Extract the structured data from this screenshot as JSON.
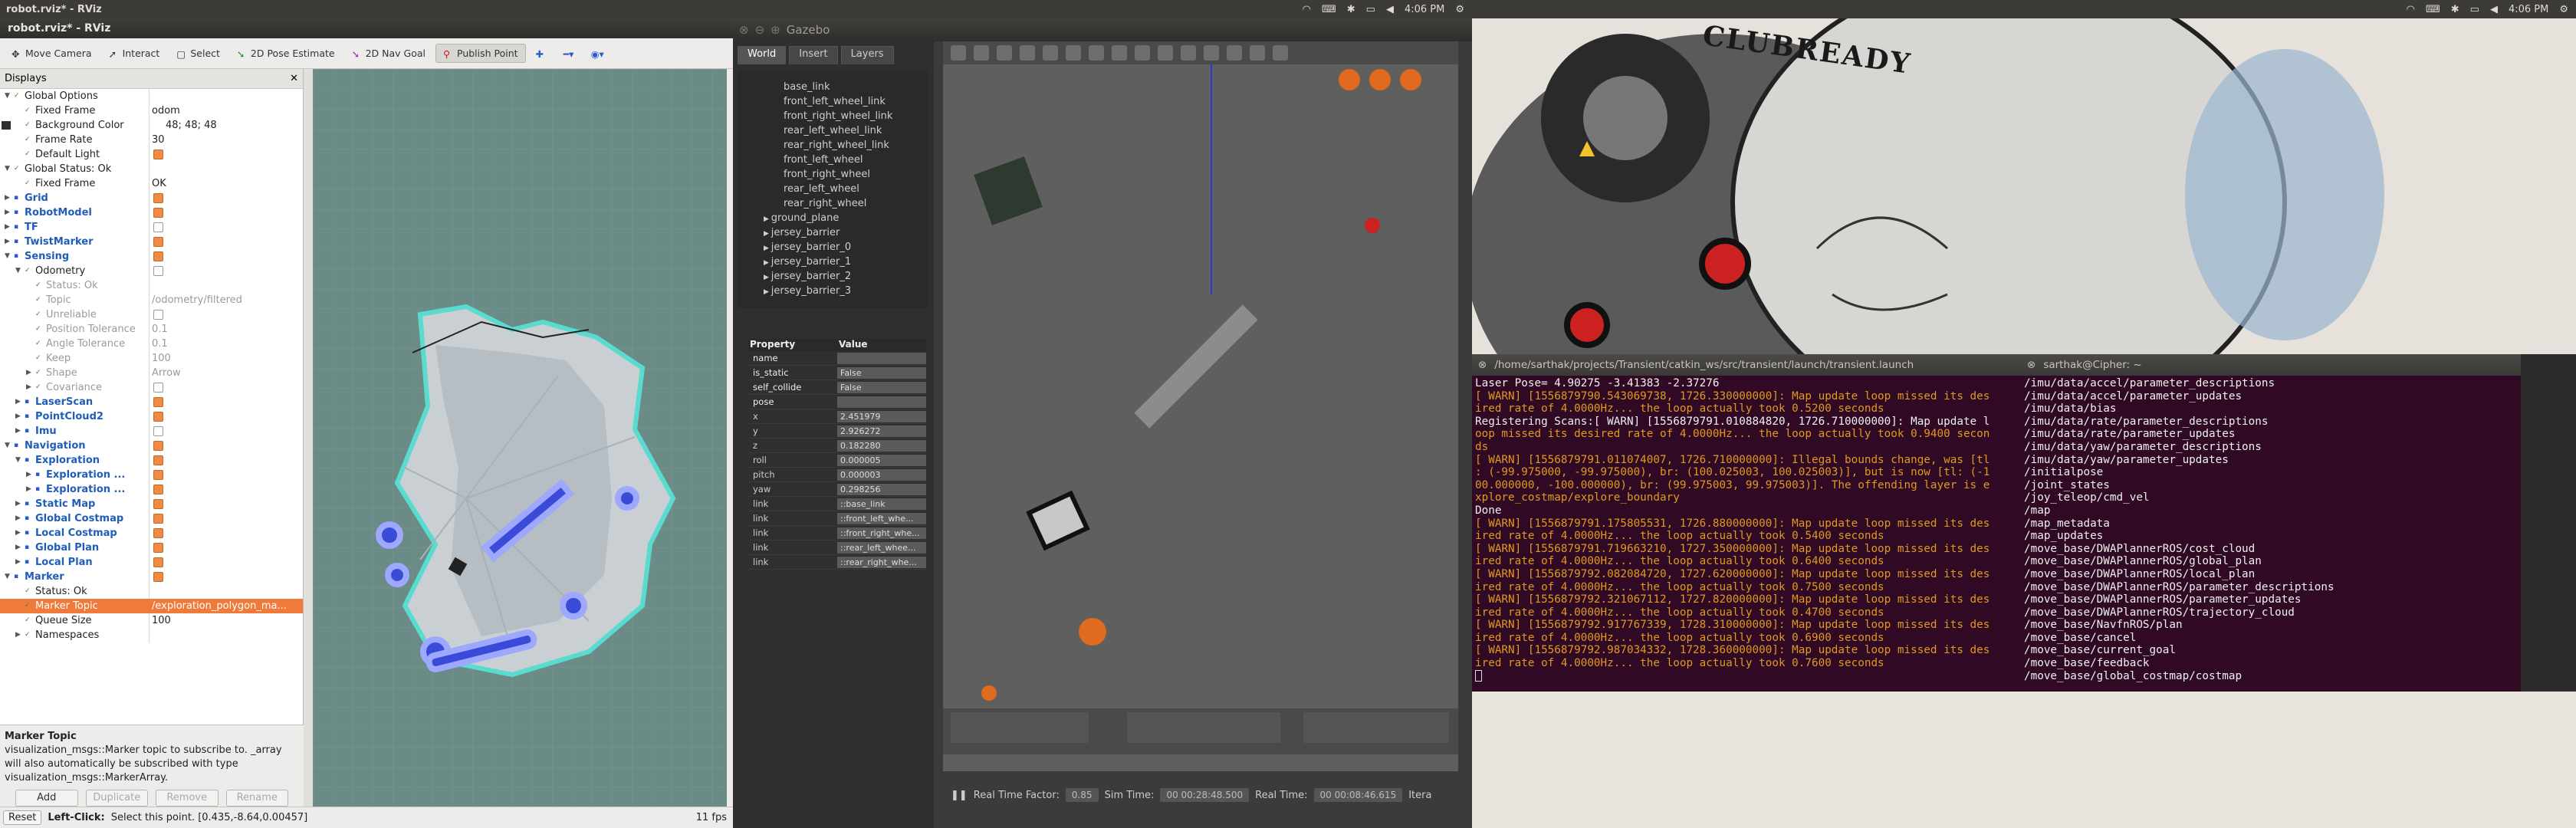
{
  "top_left_bar": {
    "title": "robot.rviz* - RViz"
  },
  "top_mid_bar": {
    "time": "4:06 PM"
  },
  "top_right_bar": {
    "time": "4:06 PM"
  },
  "rviz": {
    "window_title": "robot.rviz* - RViz",
    "toolbar": [
      "Move Camera",
      "Interact",
      "Select",
      "2D Pose Estimate",
      "2D Nav Goal",
      "Publish Point"
    ],
    "panel_title": "Displays",
    "rows": [
      {
        "name": "Global Options",
        "val": "",
        "ind": 0,
        "exp": "v",
        "blue": false
      },
      {
        "name": "Fixed Frame",
        "val": "odom",
        "ind": 1
      },
      {
        "name": "Background Color",
        "val": "48; 48; 48",
        "ind": 1,
        "swatch": true
      },
      {
        "name": "Frame Rate",
        "val": "30",
        "ind": 1
      },
      {
        "name": "Default Light",
        "val": "",
        "ind": 1,
        "chk": "on"
      },
      {
        "name": "Global Status: Ok",
        "val": "",
        "ind": 0,
        "exp": "v"
      },
      {
        "name": "Fixed Frame",
        "val": "OK",
        "ind": 1
      },
      {
        "name": "Grid",
        "val": "",
        "ind": 0,
        "exp": ">",
        "blue": true,
        "chk": "on"
      },
      {
        "name": "RobotModel",
        "val": "",
        "ind": 0,
        "exp": ">",
        "blue": true,
        "chk": "on"
      },
      {
        "name": "TF",
        "val": "",
        "ind": 0,
        "exp": ">",
        "blue": true,
        "chk": "off"
      },
      {
        "name": "TwistMarker",
        "val": "",
        "ind": 0,
        "exp": ">",
        "blue": true,
        "chk": "on"
      },
      {
        "name": "Sensing",
        "val": "",
        "ind": 0,
        "exp": "v",
        "blue": true,
        "chk": "on"
      },
      {
        "name": "Odometry",
        "val": "",
        "ind": 1,
        "exp": "v",
        "chk": "off"
      },
      {
        "name": "Status: Ok",
        "val": "",
        "ind": 2,
        "dim": true
      },
      {
        "name": "Topic",
        "val": "/odometry/filtered",
        "ind": 2,
        "dim": true
      },
      {
        "name": "Unreliable",
        "val": "",
        "ind": 2,
        "dim": true,
        "chk": "off"
      },
      {
        "name": "Position Tolerance",
        "val": "0.1",
        "ind": 2,
        "dim": true
      },
      {
        "name": "Angle Tolerance",
        "val": "0.1",
        "ind": 2,
        "dim": true
      },
      {
        "name": "Keep",
        "val": "100",
        "ind": 2,
        "dim": true
      },
      {
        "name": "Shape",
        "val": "Arrow",
        "ind": 2,
        "dim": true,
        "exp": ">"
      },
      {
        "name": "Covariance",
        "val": "",
        "ind": 2,
        "dim": true,
        "exp": ">",
        "chk": "off"
      },
      {
        "name": "LaserScan",
        "val": "",
        "ind": 1,
        "exp": ">",
        "blue": true,
        "chk": "on"
      },
      {
        "name": "PointCloud2",
        "val": "",
        "ind": 1,
        "exp": ">",
        "blue": true,
        "chk": "on"
      },
      {
        "name": "Imu",
        "val": "",
        "ind": 1,
        "exp": ">",
        "blue": true,
        "chk": "off"
      },
      {
        "name": "Navigation",
        "val": "",
        "ind": 0,
        "exp": "v",
        "blue": true,
        "chk": "on"
      },
      {
        "name": "Exploration",
        "val": "",
        "ind": 1,
        "exp": "v",
        "blue": true,
        "chk": "on"
      },
      {
        "name": "Exploration ...",
        "val": "",
        "ind": 2,
        "exp": ">",
        "blue": true,
        "chk": "on"
      },
      {
        "name": "Exploration ...",
        "val": "",
        "ind": 2,
        "exp": ">",
        "blue": true,
        "chk": "on"
      },
      {
        "name": "Static Map",
        "val": "",
        "ind": 1,
        "exp": ">",
        "blue": true,
        "chk": "on"
      },
      {
        "name": "Global Costmap",
        "val": "",
        "ind": 1,
        "exp": ">",
        "blue": true,
        "chk": "on"
      },
      {
        "name": "Local Costmap",
        "val": "",
        "ind": 1,
        "exp": ">",
        "blue": true,
        "chk": "on"
      },
      {
        "name": "Global Plan",
        "val": "",
        "ind": 1,
        "exp": ">",
        "blue": true,
        "chk": "on"
      },
      {
        "name": "Local Plan",
        "val": "",
        "ind": 1,
        "exp": ">",
        "blue": true,
        "chk": "on"
      },
      {
        "name": "Marker",
        "val": "",
        "ind": 0,
        "exp": "v",
        "blue": true,
        "chk": "on"
      },
      {
        "name": "Status: Ok",
        "val": "",
        "ind": 1
      },
      {
        "name": "Marker Topic",
        "val": "/exploration_polygon_ma...",
        "ind": 1,
        "sel": true
      },
      {
        "name": "Queue Size",
        "val": "100",
        "ind": 1
      },
      {
        "name": "Namespaces",
        "val": "",
        "ind": 1,
        "exp": ">"
      }
    ],
    "help_title": "Marker Topic",
    "help_text": "visualization_msgs::Marker topic to subscribe to. _array will also automatically be subscribed with type visualization_msgs::MarkerArray.",
    "buttons": [
      "Add",
      "Duplicate",
      "Remove",
      "Rename"
    ],
    "status_reset": "Reset",
    "status_hint_bold": "Left-Click:",
    "status_hint": "Select this point. [0.435,-8.64,0.00457]",
    "fps": "11 fps"
  },
  "gazebo": {
    "window_title": "Gazebo",
    "tabs": [
      "World",
      "Insert",
      "Layers"
    ],
    "tree": [
      {
        "t": "base_link",
        "ind": 2
      },
      {
        "t": "front_left_wheel_link",
        "ind": 2
      },
      {
        "t": "front_right_wheel_link",
        "ind": 2
      },
      {
        "t": "rear_left_wheel_link",
        "ind": 2
      },
      {
        "t": "rear_right_wheel_link",
        "ind": 2
      },
      {
        "t": "front_left_wheel",
        "ind": 2
      },
      {
        "t": "front_right_wheel",
        "ind": 2
      },
      {
        "t": "rear_left_wheel",
        "ind": 2
      },
      {
        "t": "rear_right_wheel",
        "ind": 2
      },
      {
        "t": "ground_plane",
        "ind": 1
      },
      {
        "t": "jersey_barrier",
        "ind": 1
      },
      {
        "t": "jersey_barrier_0",
        "ind": 1
      },
      {
        "t": "jersey_barrier_1",
        "ind": 1
      },
      {
        "t": "jersey_barrier_2",
        "ind": 1
      },
      {
        "t": "jersey_barrier_3",
        "ind": 1
      }
    ],
    "prop_header": [
      "Property",
      "Value"
    ],
    "props": [
      {
        "k": "name",
        "v": "",
        "bold": true
      },
      {
        "k": "is_static",
        "v": "False",
        "bold": true
      },
      {
        "k": "self_collide",
        "v": "False",
        "bold": true
      },
      {
        "k": "pose",
        "v": "",
        "bold": true
      },
      {
        "k": "x",
        "v": "2.451979"
      },
      {
        "k": "y",
        "v": "2.926272"
      },
      {
        "k": "z",
        "v": "0.182280"
      },
      {
        "k": "roll",
        "v": "0.000005"
      },
      {
        "k": "pitch",
        "v": "0.000003"
      },
      {
        "k": "yaw",
        "v": "0.298256"
      },
      {
        "k": "link",
        "v": "::base_link"
      },
      {
        "k": "link",
        "v": "::front_left_whe..."
      },
      {
        "k": "link",
        "v": "::front_right_whe..."
      },
      {
        "k": "link",
        "v": "::rear_left_whee..."
      },
      {
        "k": "link",
        "v": "::rear_right_whe..."
      }
    ],
    "rtf_label": "Real Time Factor:",
    "rtf": "0.85",
    "sim_label": "Sim Time:",
    "sim": "00 00:28:48.500",
    "real_label": "Real Time:",
    "real": "00 00:08:46.615",
    "iter_label": "Itera"
  },
  "term1": {
    "title": "/home/sarthak/projects/Transient/catkin_ws/src/transient/launch/transient.launch",
    "lines": [
      {
        "c": "wt",
        "t": "Laser Pose= 4.90275 -3.41383 -2.37276"
      },
      {
        "c": "warn",
        "t": "[ WARN] [1556879790.543069738, 1726.330000000]: Map update loop missed its des"
      },
      {
        "c": "warn",
        "t": "ired rate of 4.0000Hz... the loop actually took 0.5200 seconds"
      },
      {
        "c": "wt",
        "t": "Registering Scans:[ WARN] [1556879791.010884820, 1726.710000000]: Map update l"
      },
      {
        "c": "warn",
        "t": "oop missed its desired rate of 4.0000Hz... the loop actually took 0.9400 secon"
      },
      {
        "c": "warn",
        "t": "ds"
      },
      {
        "c": "warn",
        "t": "[ WARN] [1556879791.011074007, 1726.710000000]: Illegal bounds change, was [tl"
      },
      {
        "c": "warn",
        "t": ": (-99.975000, -99.975000), br: (100.025003, 100.025003)], but is now [tl: (-1"
      },
      {
        "c": "warn",
        "t": "00.000000, -100.000000), br: (99.975003, 99.975003)]. The offending layer is e"
      },
      {
        "c": "warn",
        "t": "xplore_costmap/explore_boundary"
      },
      {
        "c": "wt",
        "t": "Done"
      },
      {
        "c": "warn",
        "t": "[ WARN] [1556879791.175805531, 1726.880000000]: Map update loop missed its des"
      },
      {
        "c": "warn",
        "t": "ired rate of 4.0000Hz... the loop actually took 0.5400 seconds"
      },
      {
        "c": "warn",
        "t": "[ WARN] [1556879791.719663210, 1727.350000000]: Map update loop missed its des"
      },
      {
        "c": "warn",
        "t": "ired rate of 4.0000Hz... the loop actually took 0.6400 seconds"
      },
      {
        "c": "warn",
        "t": "[ WARN] [1556879792.082084720, 1727.620000000]: Map update loop missed its des"
      },
      {
        "c": "warn",
        "t": "ired rate of 4.0000Hz... the loop actually took 0.7500 seconds"
      },
      {
        "c": "warn",
        "t": "[ WARN] [1556879792.321067112, 1727.820000000]: Map update loop missed its des"
      },
      {
        "c": "warn",
        "t": "ired rate of 4.0000Hz... the loop actually took 0.4700 seconds"
      },
      {
        "c": "warn",
        "t": "[ WARN] [1556879792.917767339, 1728.310000000]: Map update loop missed its des"
      },
      {
        "c": "warn",
        "t": "ired rate of 4.0000Hz... the loop actually took 0.6900 seconds"
      },
      {
        "c": "warn",
        "t": "[ WARN] [1556879792.987034332, 1728.360000000]: Map update loop missed its des"
      },
      {
        "c": "warn",
        "t": "ired rate of 4.0000Hz... the loop actually took 0.7600 seconds"
      }
    ]
  },
  "term2": {
    "title": "sarthak@Cipher: ~",
    "lines": [
      "/imu/data/accel/parameter_descriptions",
      "/imu/data/accel/parameter_updates",
      "/imu/data/bias",
      "/imu/data/rate/parameter_descriptions",
      "/imu/data/rate/parameter_updates",
      "/imu/data/yaw/parameter_descriptions",
      "/imu/data/yaw/parameter_updates",
      "/initialpose",
      "/joint_states",
      "/joy_teleop/cmd_vel",
      "/map",
      "/map_metadata",
      "/map_updates",
      "/move_base/DWAPlannerROS/cost_cloud",
      "/move_base/DWAPlannerROS/global_plan",
      "/move_base/DWAPlannerROS/local_plan",
      "/move_base/DWAPlannerROS/parameter_descriptions",
      "/move_base/DWAPlannerROS/parameter_updates",
      "/move_base/DWAPlannerROS/trajectory_cloud",
      "/move_base/NavfnROS/plan",
      "/move_base/cancel",
      "/move_base/current_goal",
      "/move_base/feedback",
      "/move_base/global_costmap/costmap"
    ]
  },
  "wallpaper": {
    "text": "CLUBREADY"
  },
  "colors": {
    "accent": "#f07a3a",
    "terminal_bg": "#300a24",
    "warn": "#e09a1e"
  }
}
